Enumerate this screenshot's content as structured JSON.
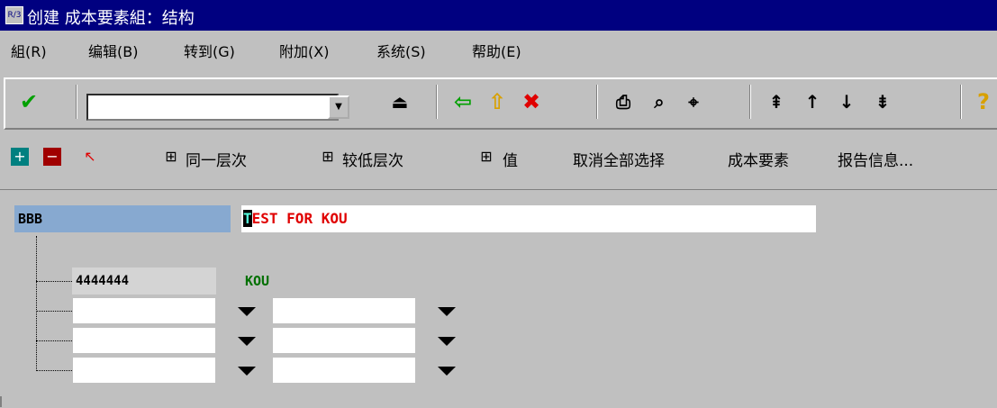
{
  "window": {
    "title": "创建 成本要素組：结构",
    "sys_icon": "R/3"
  },
  "menu": [
    "組(R)",
    "编辑(B)",
    "转到(G)",
    "附加(X)",
    "系统(S)",
    "帮助(E)"
  ],
  "toolbar": {
    "command_value": ""
  },
  "app_toolbar": {
    "same_level": "同一层次",
    "lower_level": "较低层次",
    "value": "值",
    "deselect_all": "取消全部选择",
    "cost_element": "成本要素",
    "report_info": "报告信息..."
  },
  "tree": {
    "root": {
      "name": "BBB",
      "desc_first": "T",
      "desc_rest": "EST FOR KOU"
    },
    "child": {
      "name": "4444444",
      "desc": "KOU"
    }
  },
  "colors": {
    "title_bg": "#000080",
    "root_bg": "#87a9d0",
    "desc_red": "#e00000",
    "child_desc_green": "#007000"
  }
}
